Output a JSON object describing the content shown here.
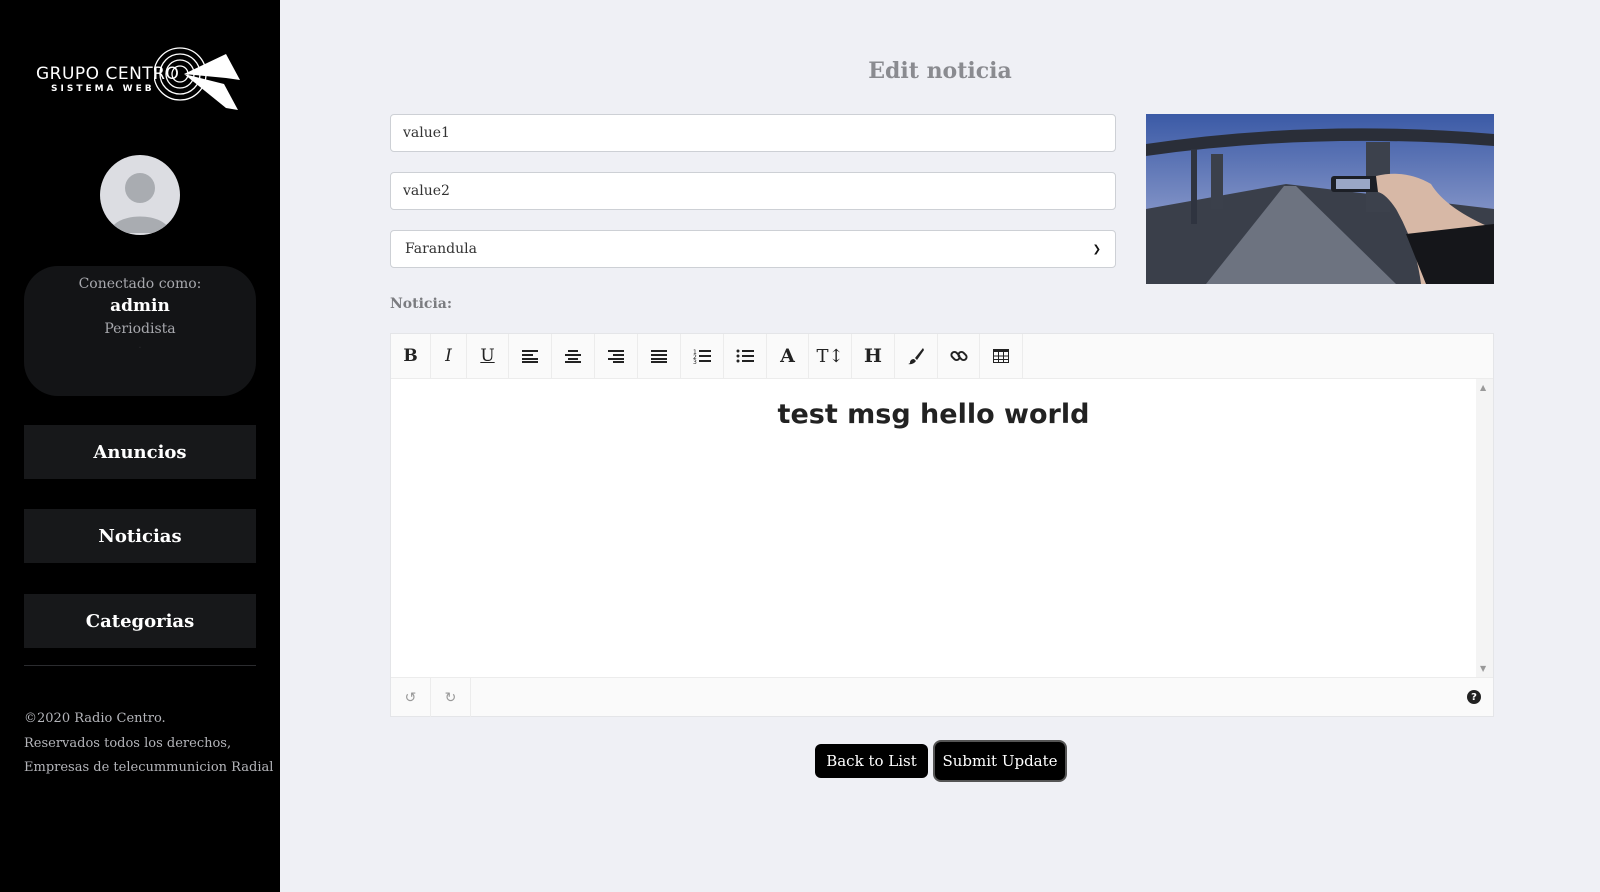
{
  "sidebar": {
    "logo": {
      "brand": "GRUPO CENTRO",
      "subtitle": "SISTEMA WEB"
    },
    "user": {
      "connected_label": "Conectado como:",
      "name": "admin",
      "role": "Periodista",
      "extra": "."
    },
    "nav": [
      {
        "label": "Anuncios"
      },
      {
        "label": "Noticias"
      },
      {
        "label": "Categorias"
      }
    ],
    "footer": {
      "line1": "©2020 Radio Centro.",
      "line2": "Reservados todos los derechos,",
      "line3": "Empresas de telecummunicion Radial"
    }
  },
  "main": {
    "title": "Edit noticia",
    "field1_value": "value1",
    "field2_value": "value2",
    "category_selected": "Farandula",
    "noticia_label": "Noticia:",
    "editor": {
      "content": "test msg hello world",
      "toolbar": [
        "bold-icon",
        "italic-icon",
        "underline-icon",
        "align-left-icon",
        "align-center-icon",
        "align-right-icon",
        "justify-icon",
        "ordered-list-icon",
        "unordered-list-icon",
        "font-color-icon",
        "font-size-icon",
        "heading-icon",
        "brush-icon",
        "link-icon",
        "table-icon"
      ],
      "bottom": [
        "undo-icon",
        "redo-icon",
        "help-icon"
      ]
    },
    "buttons": {
      "back": "Back to List",
      "submit": "Submit Update"
    }
  },
  "colors": {
    "sidebar_bg": "#000000",
    "page_bg": "#eff0f5",
    "card_bg": "#131416",
    "nav_bg": "#17181a"
  }
}
